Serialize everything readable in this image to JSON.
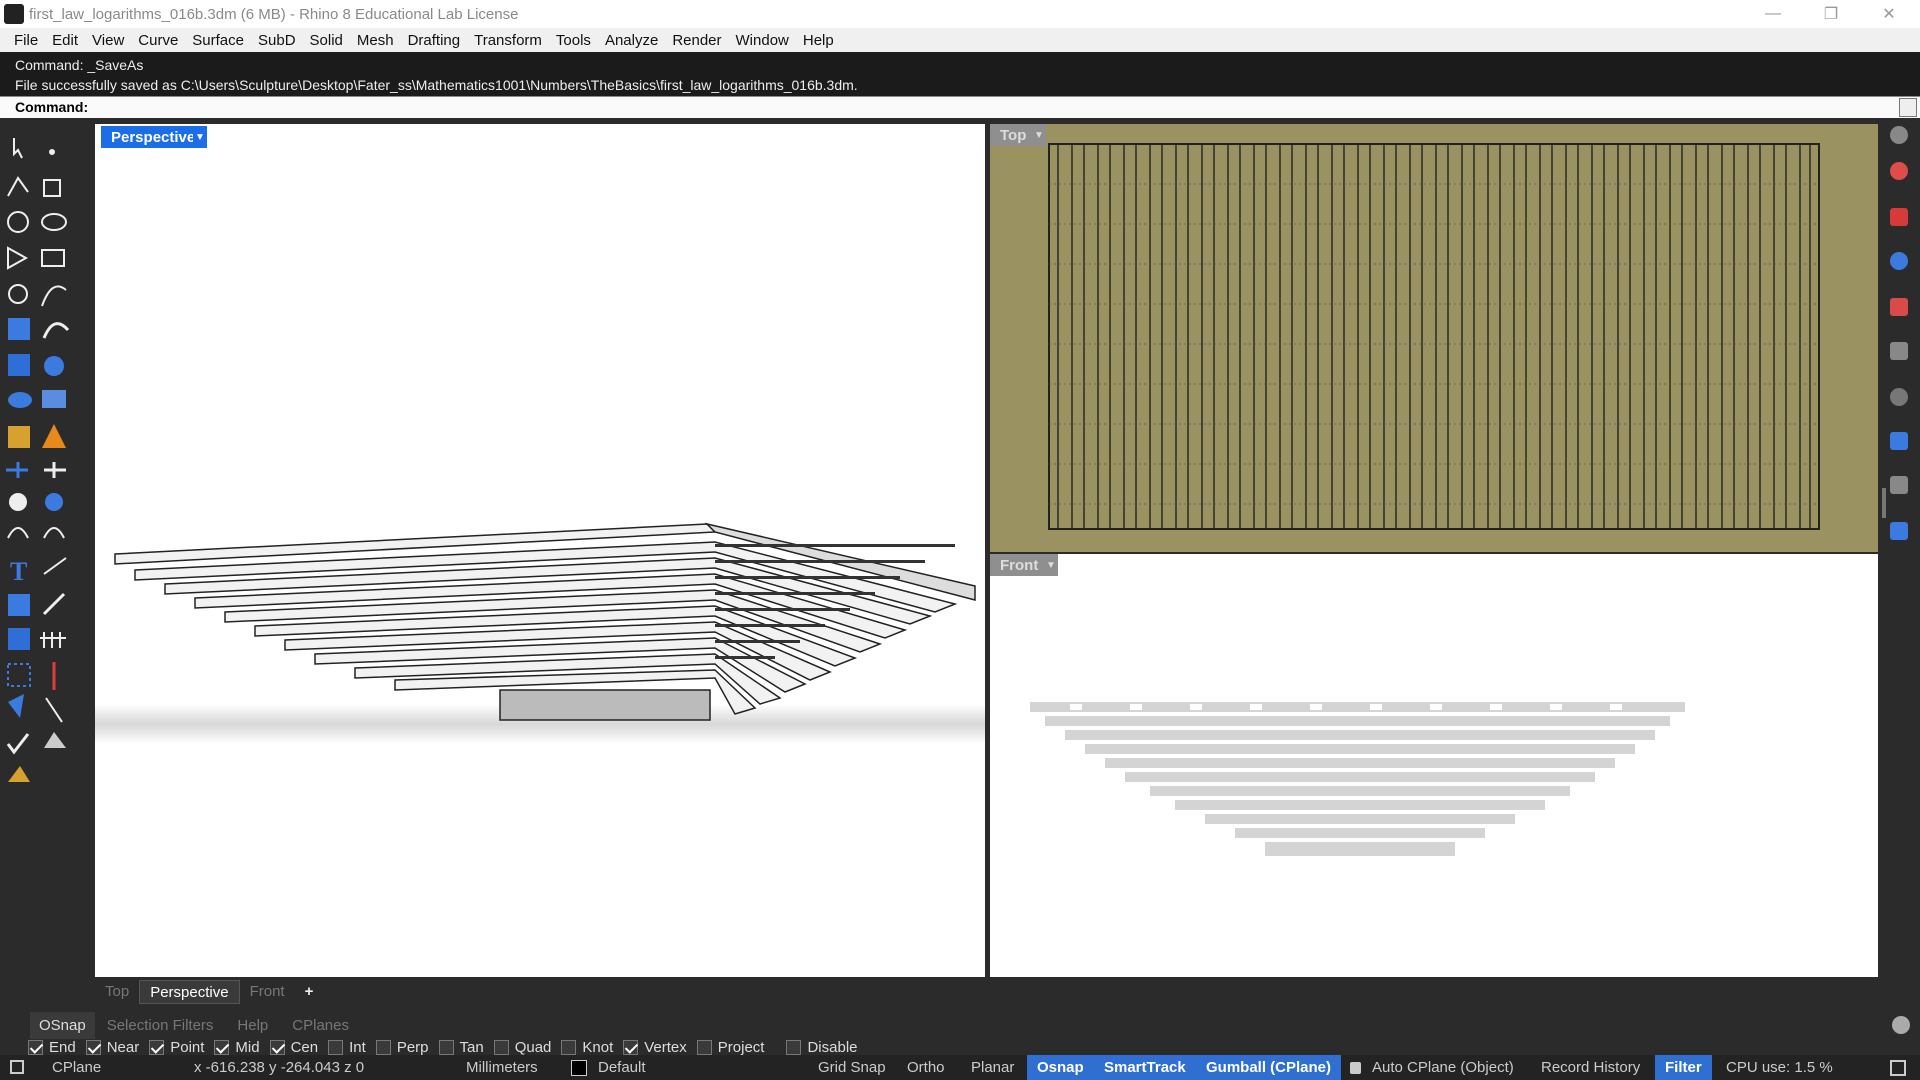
{
  "window": {
    "title": "first_law_logarithms_016b.3dm (6 MB) - Rhino 8 Educational Lab License"
  },
  "menu": [
    "File",
    "Edit",
    "View",
    "Curve",
    "Surface",
    "SubD",
    "Solid",
    "Mesh",
    "Drafting",
    "Transform",
    "Tools",
    "Analyze",
    "Render",
    "Window",
    "Help"
  ],
  "command": {
    "history_1": "Command: _SaveAs",
    "history_2": "File successfully saved as C:\\Users\\Sculpture\\Desktop\\Fater_ss\\Mathematics1001\\Numbers\\TheBasics\\first_law_logarithms_016b.3dm.",
    "prompt": "Command:"
  },
  "viewports": {
    "perspective": "Perspective",
    "top": "Top",
    "front": "Front"
  },
  "viewport_tabs": {
    "top": "Top",
    "perspective": "Perspective",
    "front": "Front",
    "add": "+"
  },
  "panels": {
    "osnap": "OSnap",
    "filters": "Selection Filters",
    "help": "Help",
    "cplanes": "CPlanes"
  },
  "osnaps": [
    {
      "label": "End",
      "on": true
    },
    {
      "label": "Near",
      "on": true
    },
    {
      "label": "Point",
      "on": true
    },
    {
      "label": "Mid",
      "on": true
    },
    {
      "label": "Cen",
      "on": true
    },
    {
      "label": "Int",
      "on": false
    },
    {
      "label": "Perp",
      "on": false
    },
    {
      "label": "Tan",
      "on": false
    },
    {
      "label": "Quad",
      "on": false
    },
    {
      "label": "Knot",
      "on": false
    },
    {
      "label": "Vertex",
      "on": true
    },
    {
      "label": "Project",
      "on": false
    },
    {
      "label": "Disable",
      "on": false
    }
  ],
  "status": {
    "cplane": "CPlane",
    "coords": "x -616.238  y -264.043  z 0",
    "units": "Millimeters",
    "layer": "Default",
    "grid_snap": "Grid Snap",
    "ortho": "Ortho",
    "planar": "Planar",
    "osnap": "Osnap",
    "smarttrack": "SmartTrack",
    "gumball": "Gumball (CPlane)",
    "auto_cplane": "Auto CPlane (Object)",
    "record_history": "Record History",
    "filter": "Filter",
    "cpu": "CPU use: 1.5 %"
  },
  "colors": {
    "accent": "#2f6fd1",
    "top_bg": "#9a9361",
    "dark": "#2b2b2b"
  }
}
